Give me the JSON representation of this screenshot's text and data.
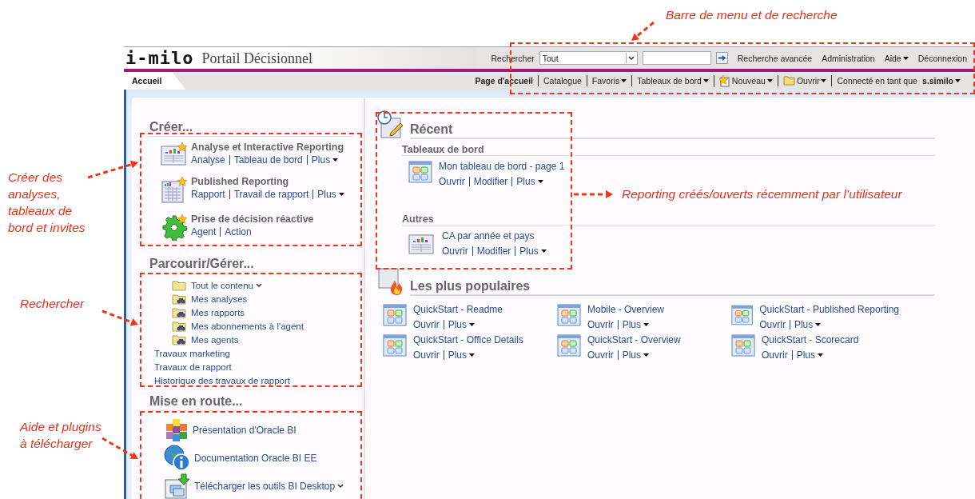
{
  "annotations": [
    {
      "text": "Barre de menu et de recherche"
    },
    {
      "text": "Créer des analyses, tableaux de bord et invites"
    },
    {
      "text": "Rechercher"
    },
    {
      "text": "Aide et plugins à télécharger"
    },
    {
      "text": "Reporting créés/ouverts récemment par l’utilisateur"
    }
  ],
  "header": {
    "logo": "i-milo",
    "title": "Portail Décisionnel",
    "search_label": "Rechercher",
    "search_scope": "Tout",
    "links": [
      {
        "label": "Recherche avancée",
        "kind": "link"
      },
      {
        "label": "Administration",
        "kind": "link"
      },
      {
        "label": "Aide",
        "kind": "menu"
      },
      {
        "label": "Déconnexion",
        "kind": "link"
      }
    ]
  },
  "tabs": [
    {
      "label": "Accueil",
      "selected": true
    }
  ],
  "navbar": [
    {
      "label": "Page d'accueil",
      "kind": "link",
      "selected": true
    },
    {
      "label": "Catalogue",
      "kind": "link",
      "selected": false
    },
    {
      "label": "Favoris",
      "kind": "menu",
      "selected": false
    },
    {
      "label": "Tableaux de bord",
      "kind": "menu",
      "selected": false
    },
    {
      "label": "Nouveau",
      "kind": "new",
      "selected": false
    },
    {
      "label": "Ouvrir",
      "kind": "open",
      "selected": false
    },
    {
      "label": "Connecté en tant que",
      "user": "s.similo",
      "kind": "user",
      "selected": false
    }
  ],
  "create": {
    "title": "Créer...",
    "items": [
      {
        "title": "Analyse et Interactive Reporting",
        "kind": "analysis",
        "links": [
          {
            "label": "Analyse",
            "menu": false
          },
          {
            "label": "Tableau de bord",
            "menu": false
          },
          {
            "label": "Plus",
            "menu": true
          }
        ]
      },
      {
        "title": "Published Reporting",
        "kind": "published",
        "links": [
          {
            "label": "Rapport",
            "menu": false
          },
          {
            "label": "Travail de rapport",
            "menu": false
          },
          {
            "label": "Plus",
            "menu": true
          }
        ]
      },
      {
        "title": "Prise de décision réactive",
        "kind": "agent",
        "links": [
          {
            "label": "Agent",
            "menu": false
          },
          {
            "label": "Action",
            "menu": false
          }
        ]
      }
    ]
  },
  "browse": {
    "title": "Parcourir/Gérer...",
    "items": [
      {
        "label": "Tout le contenu",
        "kind": "folder",
        "expandable": true
      },
      {
        "label": "Mes analyses",
        "kind": "search-folder",
        "expandable": false
      },
      {
        "label": "Mes rapports",
        "kind": "search-folder",
        "expandable": false
      },
      {
        "label": "Mes abonnements à l'agent",
        "kind": "search-folder",
        "expandable": false
      },
      {
        "label": "Mes agents",
        "kind": "search-folder",
        "expandable": false
      },
      {
        "label": "Travaux marketing",
        "kind": "link",
        "expandable": false
      },
      {
        "label": "Travaux de rapport",
        "kind": "link",
        "expandable": false
      },
      {
        "label": "Historique des travaux de rapport",
        "kind": "link",
        "expandable": false
      }
    ]
  },
  "getting_started": {
    "title": "Mise en route...",
    "items": [
      {
        "label": "Présentation d'Oracle BI",
        "kind": "cubes",
        "expandable": false
      },
      {
        "label": "Documentation Oracle BI EE",
        "kind": "info",
        "expandable": false
      },
      {
        "label": "Télécharger les outils BI Desktop",
        "kind": "download",
        "expandable": true
      }
    ]
  },
  "recent": {
    "title": "Récent",
    "groups": [
      {
        "title": "Tableaux de bord",
        "items": [
          {
            "name": "Mon tableau de bord - page 1",
            "kind": "dashboard",
            "actions": [
              {
                "label": "Ouvrir",
                "menu": false
              },
              {
                "label": "Modifier",
                "menu": false
              },
              {
                "label": "Plus",
                "menu": true
              }
            ]
          }
        ]
      },
      {
        "title": "Autres",
        "items": [
          {
            "name": "CA par année et pays",
            "kind": "analysis",
            "actions": [
              {
                "label": "Ouvrir",
                "menu": false
              },
              {
                "label": "Modifier",
                "menu": false
              },
              {
                "label": "Plus",
                "menu": true
              }
            ]
          }
        ]
      }
    ]
  },
  "popular": {
    "title": "Les plus populaires",
    "items": [
      {
        "name": "QuickStart - Readme",
        "kind": "dashboard",
        "actions": [
          {
            "label": "Ouvrir",
            "menu": false
          },
          {
            "label": "Plus",
            "menu": true
          }
        ]
      },
      {
        "name": "Mobile - Overview",
        "kind": "dashboard",
        "actions": [
          {
            "label": "Ouvrir",
            "menu": false
          },
          {
            "label": "Plus",
            "menu": true
          }
        ]
      },
      {
        "name": "QuickStart - Published Reporting",
        "kind": "dashboard",
        "actions": [
          {
            "label": "Ouvrir",
            "menu": false
          },
          {
            "label": "Plus",
            "menu": true
          }
        ]
      },
      {
        "name": "QuickStart - Office Details",
        "kind": "dashboard",
        "actions": [
          {
            "label": "Ouvrir",
            "menu": false
          },
          {
            "label": "Plus",
            "menu": true
          }
        ]
      },
      {
        "name": "QuickStart - Overview",
        "kind": "dashboard",
        "actions": [
          {
            "label": "Ouvrir",
            "menu": false
          },
          {
            "label": "Plus",
            "menu": true
          }
        ]
      },
      {
        "name": "QuickStart - Scorecard",
        "kind": "dashboard",
        "actions": [
          {
            "label": "Ouvrir",
            "menu": false
          },
          {
            "label": "Plus",
            "menu": true
          }
        ]
      }
    ]
  }
}
